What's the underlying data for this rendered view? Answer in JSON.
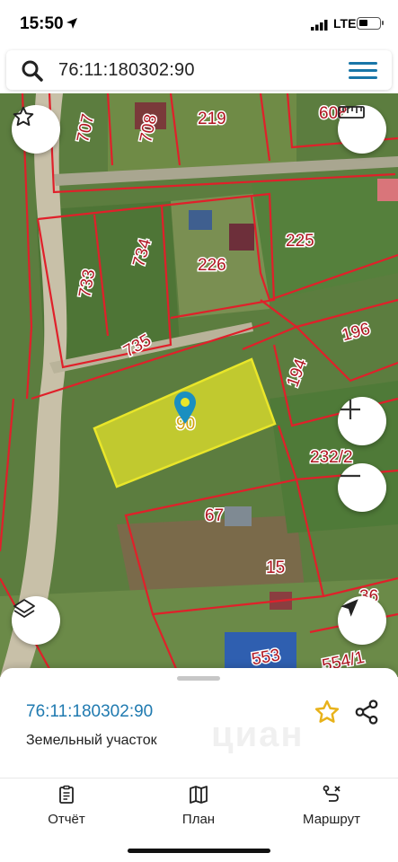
{
  "status": {
    "time": "15:50",
    "network": "LTE"
  },
  "search": {
    "query": "76:11:180302:90"
  },
  "map": {
    "parcels": [
      {
        "label": "707"
      },
      {
        "label": "708"
      },
      {
        "label": "219"
      },
      {
        "label": "608"
      },
      {
        "label": "733"
      },
      {
        "label": "734"
      },
      {
        "label": "226"
      },
      {
        "label": "225"
      },
      {
        "label": "735"
      },
      {
        "label": "196"
      },
      {
        "label": "194"
      },
      {
        "label": "90"
      },
      {
        "label": "232/2"
      },
      {
        "label": "67"
      },
      {
        "label": "15"
      },
      {
        "label": "553"
      },
      {
        "label": "554/1"
      },
      {
        "label": "36"
      }
    ],
    "colors": {
      "boundary": "#e0202a",
      "selected_fill": "#e9e62a",
      "pin": "#1a8fc0"
    }
  },
  "controls": {
    "favorite": "star-icon",
    "ruler": "ruler-icon",
    "zoom_in": "plus-icon",
    "zoom_out": "minus-icon",
    "layers": "layers-icon",
    "locate": "navigation-arrow-icon"
  },
  "sheet": {
    "parcel_id": "76:11:180302:90",
    "parcel_type": "Земельный участок",
    "watermark": "циан"
  },
  "tabs": [
    {
      "label": "Отчёт",
      "icon": "report-icon"
    },
    {
      "label": "План",
      "icon": "map-plan-icon"
    },
    {
      "label": "Маршрут",
      "icon": "route-icon"
    }
  ],
  "accent": "#1f7ab0"
}
